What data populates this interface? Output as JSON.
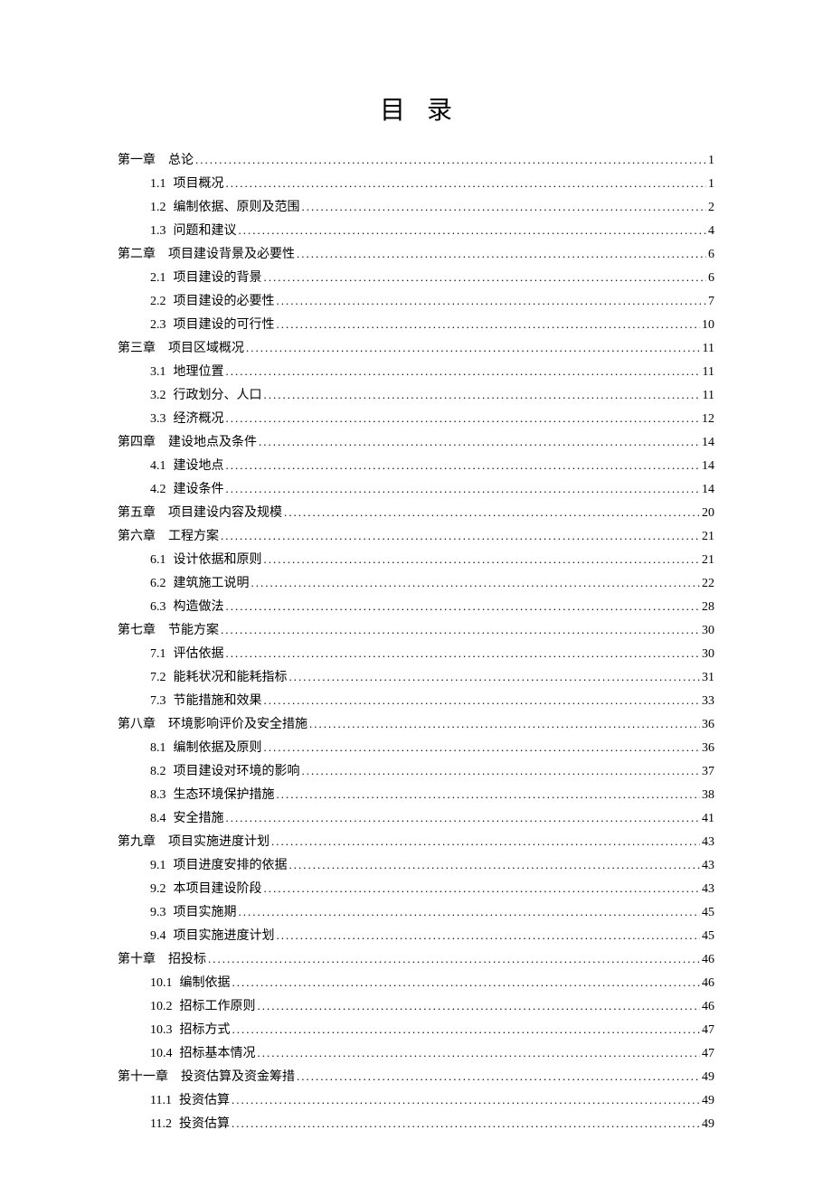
{
  "title": "目录",
  "entries": [
    {
      "level": 0,
      "num": "第一章",
      "text": "总论",
      "page": "1"
    },
    {
      "level": 1,
      "num": "1.1",
      "text": "项目概况",
      "page": "1"
    },
    {
      "level": 1,
      "num": "1.2",
      "text": "编制依据、原则及范围",
      "page": "2"
    },
    {
      "level": 1,
      "num": "1.3",
      "text": "问题和建议",
      "page": "4"
    },
    {
      "level": 0,
      "num": "第二章",
      "text": "项目建设背景及必要性",
      "page": "6"
    },
    {
      "level": 1,
      "num": "2.1",
      "text": "项目建设的背景",
      "page": "6"
    },
    {
      "level": 1,
      "num": "2.2",
      "text": "项目建设的必要性",
      "page": "7"
    },
    {
      "level": 1,
      "num": "2.3",
      "text": "项目建设的可行性",
      "page": "10"
    },
    {
      "level": 0,
      "num": "第三章",
      "text": "项目区域概况",
      "page": "11"
    },
    {
      "level": 1,
      "num": "3.1",
      "text": "地理位置",
      "page": "11"
    },
    {
      "level": 1,
      "num": "3.2",
      "text": "行政划分、人口",
      "page": "11"
    },
    {
      "level": 1,
      "num": "3.3",
      "text": "经济概况",
      "page": "12"
    },
    {
      "level": 0,
      "num": "第四章",
      "text": "建设地点及条件",
      "page": "14"
    },
    {
      "level": 1,
      "num": "4.1",
      "text": "建设地点",
      "page": "14"
    },
    {
      "level": 1,
      "num": "4.2",
      "text": "建设条件",
      "page": "14"
    },
    {
      "level": 0,
      "num": "第五章",
      "text": "项目建设内容及规模",
      "page": "20"
    },
    {
      "level": 0,
      "num": "第六章",
      "text": "工程方案",
      "page": "21"
    },
    {
      "level": 1,
      "num": "6.1",
      "text": "设计依据和原则",
      "page": "21"
    },
    {
      "level": 1,
      "num": "6.2",
      "text": "建筑施工说明",
      "page": "22"
    },
    {
      "level": 1,
      "num": "6.3",
      "text": "构造做法",
      "page": "28"
    },
    {
      "level": 0,
      "num": "第七章",
      "text": "节能方案",
      "page": "30"
    },
    {
      "level": 1,
      "num": "7.1",
      "text": "评估依据",
      "page": "30"
    },
    {
      "level": 1,
      "num": "7.2",
      "text": "能耗状况和能耗指标",
      "page": "31"
    },
    {
      "level": 1,
      "num": "7.3",
      "text": "节能措施和效果",
      "page": "33"
    },
    {
      "level": 0,
      "num": "第八章",
      "text": "环境影响评价及安全措施",
      "page": "36"
    },
    {
      "level": 1,
      "num": "8.1",
      "text": "编制依据及原则",
      "page": "36"
    },
    {
      "level": 1,
      "num": "8.2",
      "text": "项目建设对环境的影响",
      "page": "37"
    },
    {
      "level": 1,
      "num": "8.3",
      "text": "生态环境保护措施",
      "page": "38"
    },
    {
      "level": 1,
      "num": "8.4",
      "text": "安全措施",
      "page": "41"
    },
    {
      "level": 0,
      "num": "第九章",
      "text": "项目实施进度计划",
      "page": "43"
    },
    {
      "level": 1,
      "num": "9.1",
      "text": "项目进度安排的依据",
      "page": "43"
    },
    {
      "level": 1,
      "num": "9.2",
      "text": "本项目建设阶段",
      "page": "43"
    },
    {
      "level": 1,
      "num": "9.3",
      "text": "项目实施期",
      "page": "45"
    },
    {
      "level": 1,
      "num": "9.4",
      "text": "项目实施进度计划",
      "page": "45"
    },
    {
      "level": 0,
      "num": "第十章",
      "text": "招投标",
      "page": "46"
    },
    {
      "level": 1,
      "num": "10.1",
      "text": "编制依据",
      "page": "46"
    },
    {
      "level": 1,
      "num": "10.2",
      "text": "招标工作原则",
      "page": "46"
    },
    {
      "level": 1,
      "num": "10.3",
      "text": "招标方式",
      "page": "47"
    },
    {
      "level": 1,
      "num": "10.4",
      "text": "招标基本情况",
      "page": "47"
    },
    {
      "level": 0,
      "num": "第十一章",
      "text": "投资估算及资金筹措",
      "page": "49"
    },
    {
      "level": 1,
      "num": "11.1",
      "text": "投资估算",
      "page": "49"
    },
    {
      "level": 1,
      "num": "11.2",
      "text": "投资估算",
      "page": "49"
    }
  ]
}
